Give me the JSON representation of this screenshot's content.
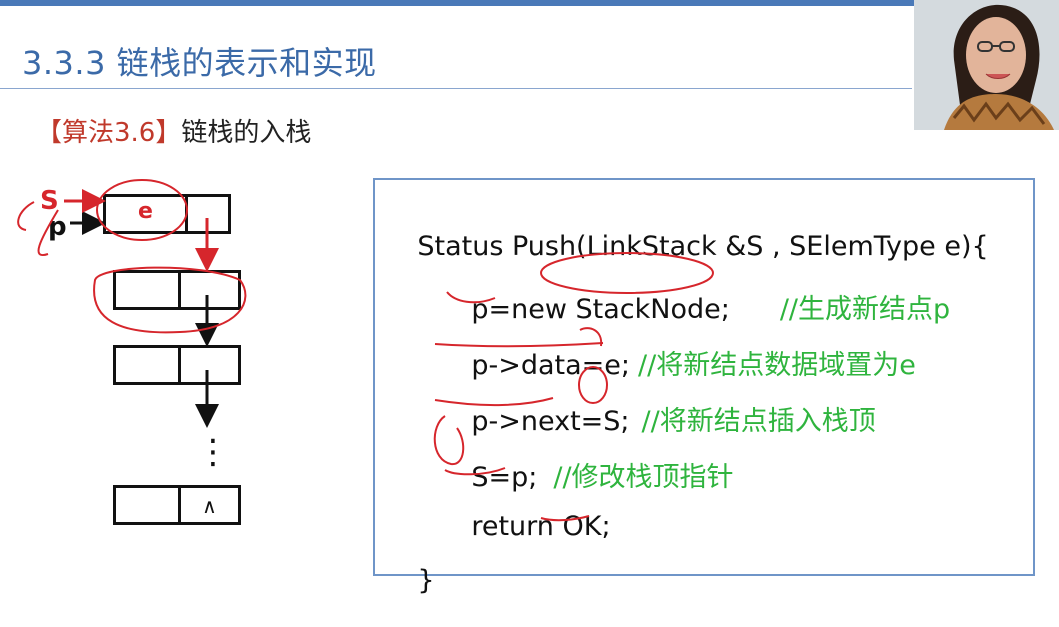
{
  "title": "3.3.3 链栈的表示和实现",
  "subtitle": {
    "tag": "【算法3.6】",
    "text": "链栈的入栈"
  },
  "diagram": {
    "label_s": "S",
    "label_p": "p",
    "new_node_value": "e",
    "null_marker": "∧",
    "ellipsis": "⋮"
  },
  "code": {
    "lines": [
      {
        "code": "Status Push(LinkStack &S , SElemType e){",
        "comment": ""
      },
      {
        "code": "p=new StackNode;",
        "comment": "//生成新结点p"
      },
      {
        "code": "p->data=e;",
        "comment": "//将新结点数据域置为e"
      },
      {
        "code": "p->next=S;",
        "comment": "//将新结点插入栈顶"
      },
      {
        "code": "S=p;",
        "comment": "//修改栈顶指针"
      },
      {
        "code": "return OK;",
        "comment": ""
      },
      {
        "code": "}",
        "comment": ""
      }
    ]
  },
  "colors": {
    "accent": "#3b6aa8",
    "annotation": "#d6262c",
    "comment": "#2fb43e",
    "border": "#6f95c8"
  }
}
